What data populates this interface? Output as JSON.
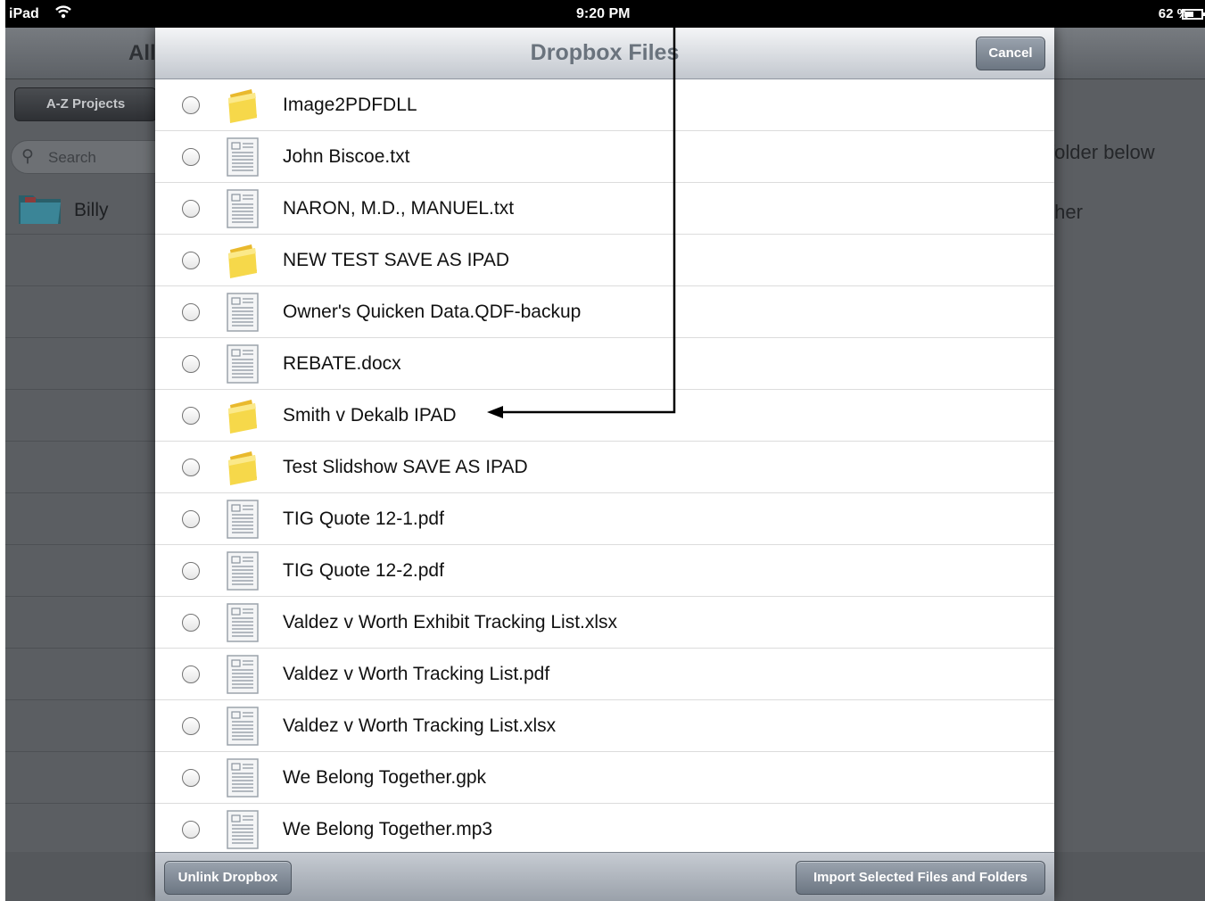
{
  "status_bar": {
    "device": "iPad",
    "time": "9:20 PM",
    "battery": "62 %"
  },
  "background_app": {
    "nav_title": "All",
    "sort_button": "A-Z Projects",
    "search_placeholder": "Search",
    "folder_name": "Billy",
    "hint_line1": "folder below",
    "hint_line2": "ther"
  },
  "modal": {
    "title": "Dropbox Files",
    "cancel_label": "Cancel",
    "unlink_label": "Unlink Dropbox",
    "import_label": "Import Selected Files and Folders",
    "files": [
      {
        "name": "Image2PDFDLL",
        "type": "folder-icon",
        "checked": false
      },
      {
        "name": "John Biscoe.txt",
        "type": "document-icon",
        "checked": false
      },
      {
        "name": "NARON, M.D., MANUEL.txt",
        "type": "document-icon",
        "checked": false
      },
      {
        "name": "NEW TEST SAVE AS IPAD",
        "type": "folder-icon",
        "checked": false
      },
      {
        "name": "Owner's Quicken Data.QDF-backup",
        "type": "document-icon",
        "checked": false
      },
      {
        "name": "REBATE.docx",
        "type": "document-icon",
        "checked": false
      },
      {
        "name": "Smith v Dekalb IPAD",
        "type": "folder-icon",
        "checked": false
      },
      {
        "name": "Test Slidshow SAVE AS IPAD",
        "type": "folder-icon",
        "checked": false
      },
      {
        "name": "TIG Quote 12-1.pdf",
        "type": "document-icon",
        "checked": false
      },
      {
        "name": "TIG Quote 12-2.pdf",
        "type": "document-icon",
        "checked": false
      },
      {
        "name": "Valdez v Worth Exhibit Tracking List.xlsx",
        "type": "document-icon",
        "checked": false
      },
      {
        "name": "Valdez v Worth Tracking List.pdf",
        "type": "document-icon",
        "checked": false
      },
      {
        "name": "Valdez v Worth Tracking List.xlsx",
        "type": "document-icon",
        "checked": false
      },
      {
        "name": "We Belong Together.gpk",
        "type": "document-icon",
        "checked": false
      },
      {
        "name": "We Belong Together.mp3",
        "type": "document-icon",
        "checked": false
      }
    ]
  },
  "colors": {
    "folder": "#f6d84a",
    "header_text": "#6a737d",
    "button_blue_gray": "#7e8894"
  }
}
